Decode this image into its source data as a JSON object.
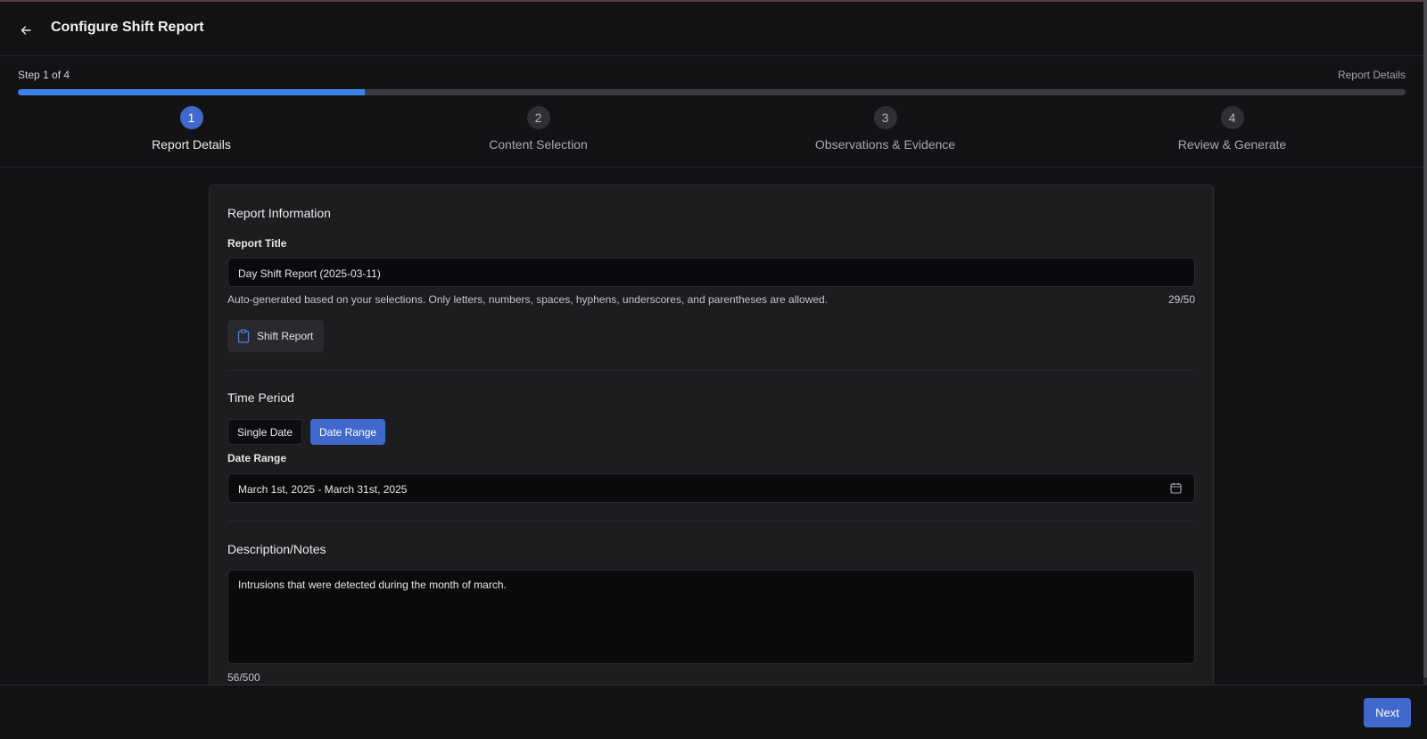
{
  "header": {
    "title": "Configure Shift Report",
    "back_icon": "arrow-left-icon"
  },
  "progress": {
    "step_count": "Step 1 of 4",
    "current_step_name": "Report Details",
    "fill_percent": 25,
    "accent_color": "#3b82e6",
    "steps": [
      {
        "number": "1",
        "label": "Report Details",
        "active": true
      },
      {
        "number": "2",
        "label": "Content Selection",
        "active": false
      },
      {
        "number": "3",
        "label": "Observations & Evidence",
        "active": false
      },
      {
        "number": "4",
        "label": "Review & Generate",
        "active": false
      }
    ]
  },
  "report_info": {
    "section_title": "Report Information",
    "title_label": "Report Title",
    "title_value": "Day Shift Report (2025-03-11)",
    "helper": "Auto-generated based on your selections. Only letters, numbers, spaces, hyphens, underscores, and parentheses are allowed.",
    "char_count": "29/50",
    "report_type": "Shift Report",
    "report_type_icon": "clipboard-icon"
  },
  "time_period": {
    "section_title": "Time Period",
    "options": [
      "Single Date",
      "Date Range"
    ],
    "selected": "Date Range",
    "range_label": "Date Range",
    "range_value": "March 1st, 2025 - March 31st, 2025",
    "calendar_icon": "calendar-icon"
  },
  "notes": {
    "section_title": "Description/Notes",
    "value": "Intrusions that were detected during the month of march.",
    "char_count": "56/500"
  },
  "footer": {
    "next_label": "Next",
    "primary_color": "#4169cc"
  }
}
